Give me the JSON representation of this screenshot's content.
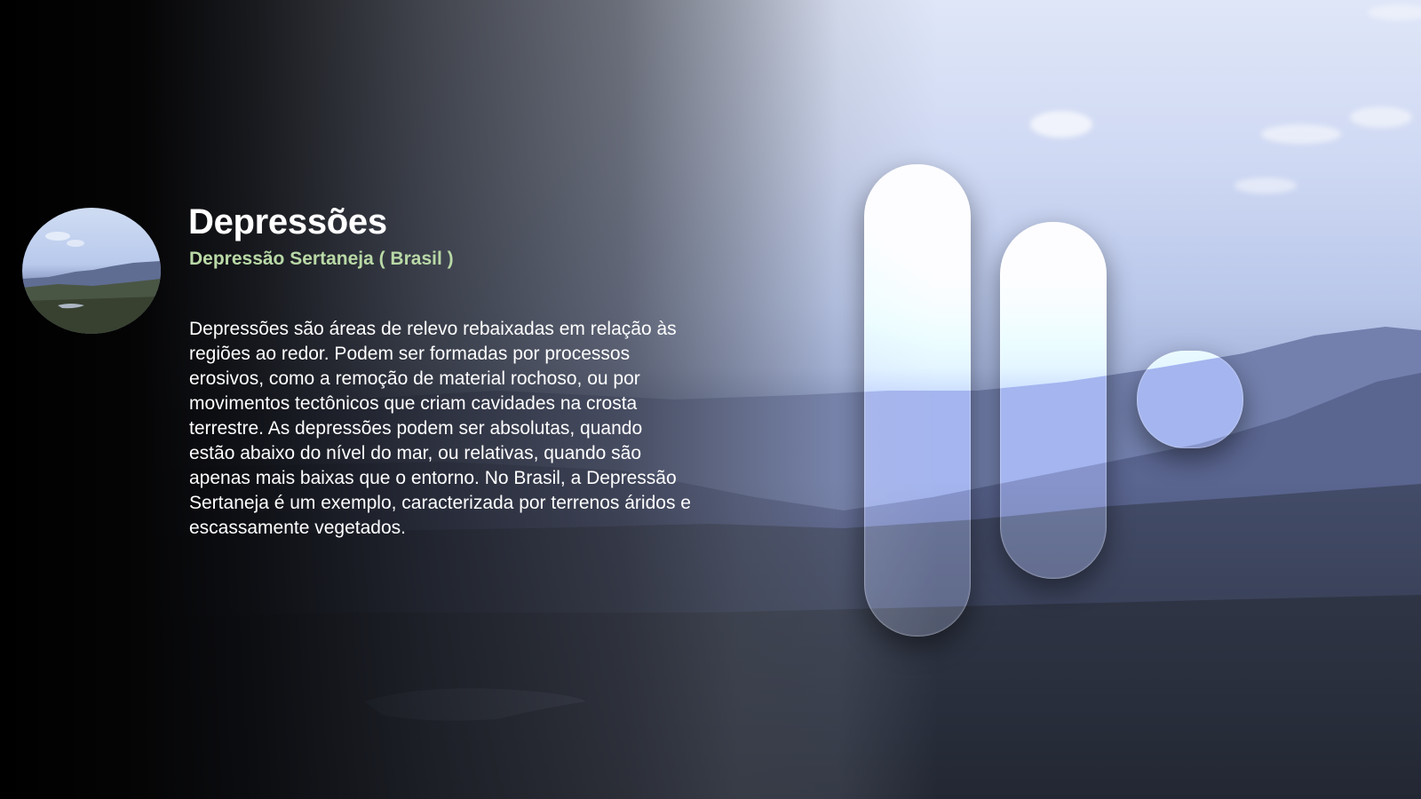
{
  "slide": {
    "title": "Depressões",
    "subtitle": "Depressão Sertaneja ( Brasil )",
    "body": "Depressões são áreas de relevo rebaixadas em relação às regiões ao redor. Podem ser formadas por processos erosivos, como a remoção de material rochoso, ou por movimentos tectônicos que criam cavidades na crosta terrestre. As depressões podem ser absolutas, quando estão abaixo do nível do mar, ou relativas, quando são apenas mais baixas que o entorno. No Brasil, a Depressão Sertaneja é um exemplo, caracterizada por terrenos áridos e escassamente vegetados."
  },
  "colors": {
    "title": "#ffffff",
    "subtitle": "#b9d9a6",
    "body": "#ffffff",
    "left_overlay": "#000000"
  },
  "icons": {
    "thumbnail": "landscape-thumbnail-image",
    "decor": "glass-pill-shapes"
  }
}
